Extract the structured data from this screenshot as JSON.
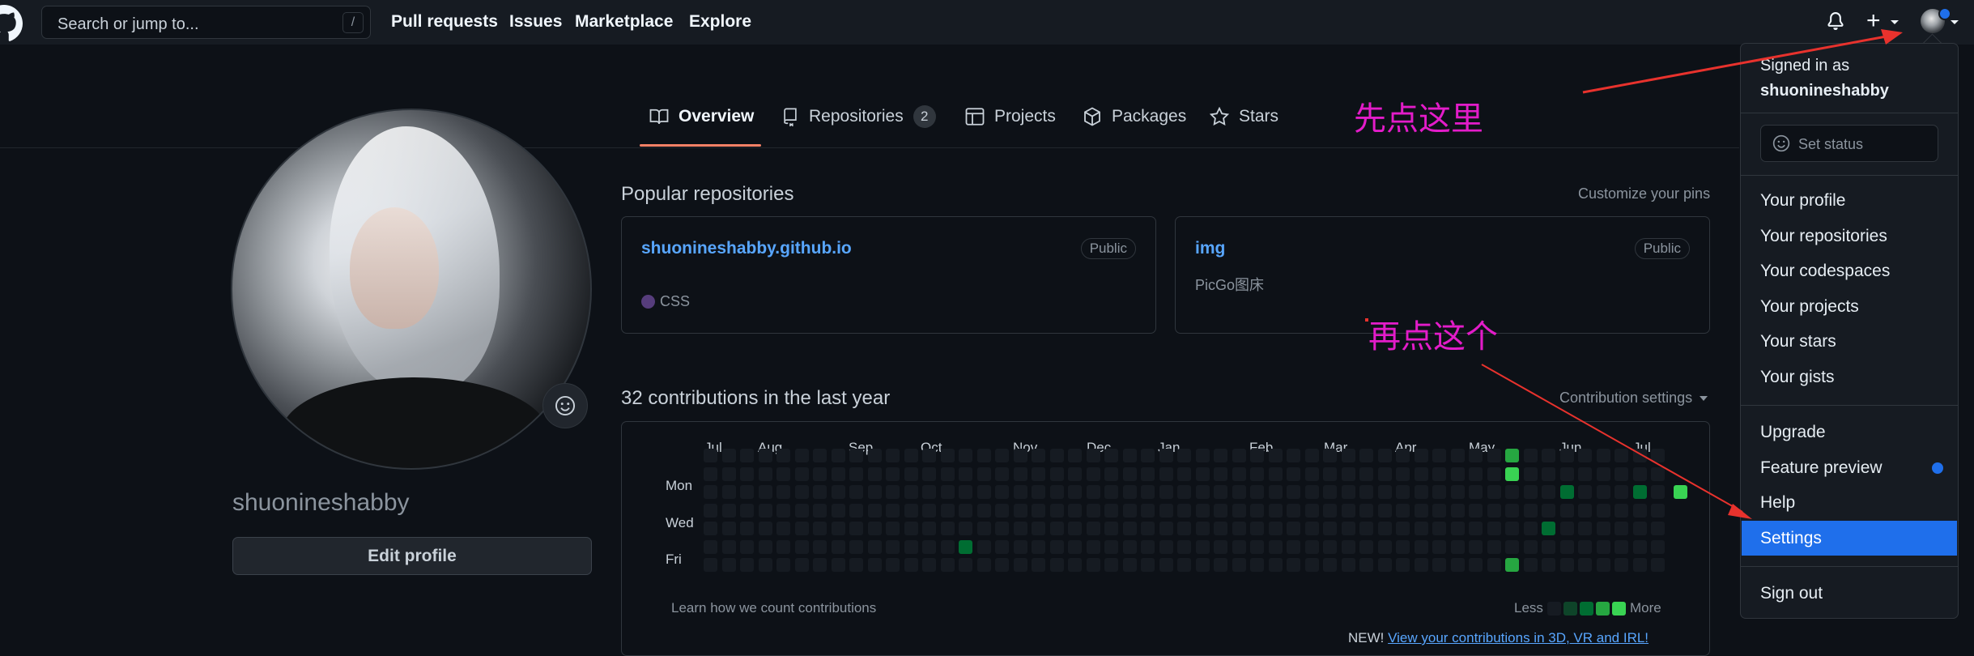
{
  "header": {
    "search_placeholder": "Search or jump to...",
    "search_shortcut": "/",
    "nav": [
      "Pull requests",
      "Issues",
      "Marketplace",
      "Explore"
    ],
    "plus_label": "+",
    "accent": "#1f6feb"
  },
  "tabs": [
    {
      "label": "Overview",
      "icon": "book-icon",
      "active": true
    },
    {
      "label": "Repositories",
      "icon": "repo-icon",
      "count": "2"
    },
    {
      "label": "Projects",
      "icon": "table-icon"
    },
    {
      "label": "Packages",
      "icon": "package-icon"
    },
    {
      "label": "Stars",
      "icon": "star-icon"
    }
  ],
  "profile": {
    "username": "shuonineshabby",
    "edit_label": "Edit profile"
  },
  "popular": {
    "title": "Popular repositories",
    "customize": "Customize your pins",
    "repos": [
      {
        "name": "shuonineshabby.github.io",
        "visibility": "Public",
        "language": "CSS",
        "lang_color": "#563d7c"
      },
      {
        "name": "img",
        "visibility": "Public",
        "description": "PicGo图床"
      }
    ]
  },
  "contributions": {
    "title": "32 contributions in the last year",
    "settings": "Contribution settings",
    "months": [
      "Jul",
      "Aug",
      "Sep",
      "Oct",
      "Nov",
      "Dec",
      "Jan",
      "Feb",
      "Mar",
      "Apr",
      "May",
      "Jun",
      "Jul"
    ],
    "days": [
      "Mon",
      "Wed",
      "Fri"
    ],
    "learn": "Learn how we count contributions",
    "less": "Less",
    "more": "More",
    "new_label": "NEW!",
    "new_link": "View your contributions in 3D, VR and IRL!"
  },
  "menu": {
    "signed_in_as": "Signed in as",
    "user": "shuonineshabby",
    "set_status": "Set status",
    "group1": [
      "Your profile",
      "Your repositories",
      "Your codespaces",
      "Your projects",
      "Your stars",
      "Your gists"
    ],
    "group2": [
      "Upgrade",
      "Feature preview",
      "Help",
      "Settings"
    ],
    "sign_out": "Sign out",
    "highlight_color": "#1f6feb"
  },
  "annotations": {
    "first": "先点这里",
    "second": "再点这个",
    "color": "#e31cc9",
    "arrow_color": "#e8322d"
  }
}
